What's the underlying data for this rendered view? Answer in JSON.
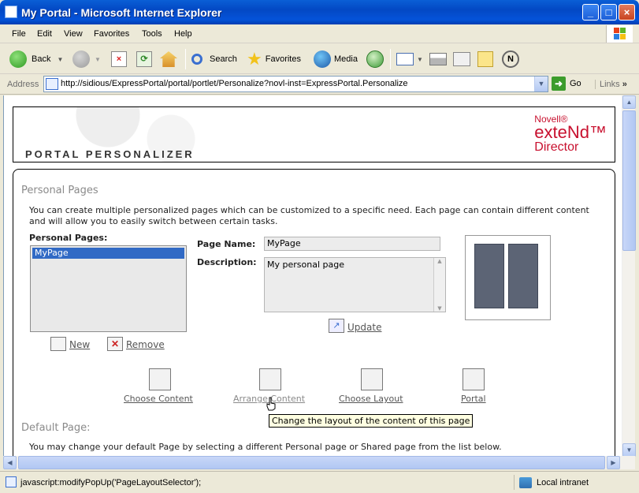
{
  "window": {
    "title": "My Portal - Microsoft Internet Explorer"
  },
  "menubar": [
    "File",
    "Edit",
    "View",
    "Favorites",
    "Tools",
    "Help"
  ],
  "toolbar": {
    "back": "Back",
    "search": "Search",
    "favorites": "Favorites",
    "media": "Media"
  },
  "address": {
    "label": "Address",
    "url": "http://sidious/ExpressPortal/portal/portlet/Personalize?novl-inst=ExpressPortal.Personalize",
    "go": "Go",
    "links": "Links"
  },
  "page": {
    "header": {
      "title": "PORTAL PERSONALIZER",
      "logo_novell": "Novell®",
      "logo_extend": "exteNd™",
      "logo_director": "Director"
    },
    "personal_pages": {
      "heading": "Personal Pages",
      "intro": "You can create multiple personalized pages which can be customized to a specific need. Each page can contain different content and will allow you to easily switch between certain tasks.",
      "list_label": "Personal Pages:",
      "list_items": [
        "MyPage"
      ],
      "page_name_label": "Page Name:",
      "page_name_value": "MyPage",
      "description_label": "Description:",
      "description_value": "My personal page",
      "update": "Update",
      "new": "New",
      "remove": "Remove"
    },
    "actions": {
      "choose_content": "Choose Content",
      "arrange_content": "Arrange Content",
      "choose_layout": "Choose Layout",
      "portal": "Portal"
    },
    "tooltip": "Change the layout of the content of this page",
    "default_page": {
      "heading": "Default Page:",
      "text": "You may change your default Page by selecting a different Personal page or Shared page from the list below."
    }
  },
  "status": {
    "message": "javascript:modifyPopUp('PageLayoutSelector');",
    "zone": "Local intranet"
  }
}
